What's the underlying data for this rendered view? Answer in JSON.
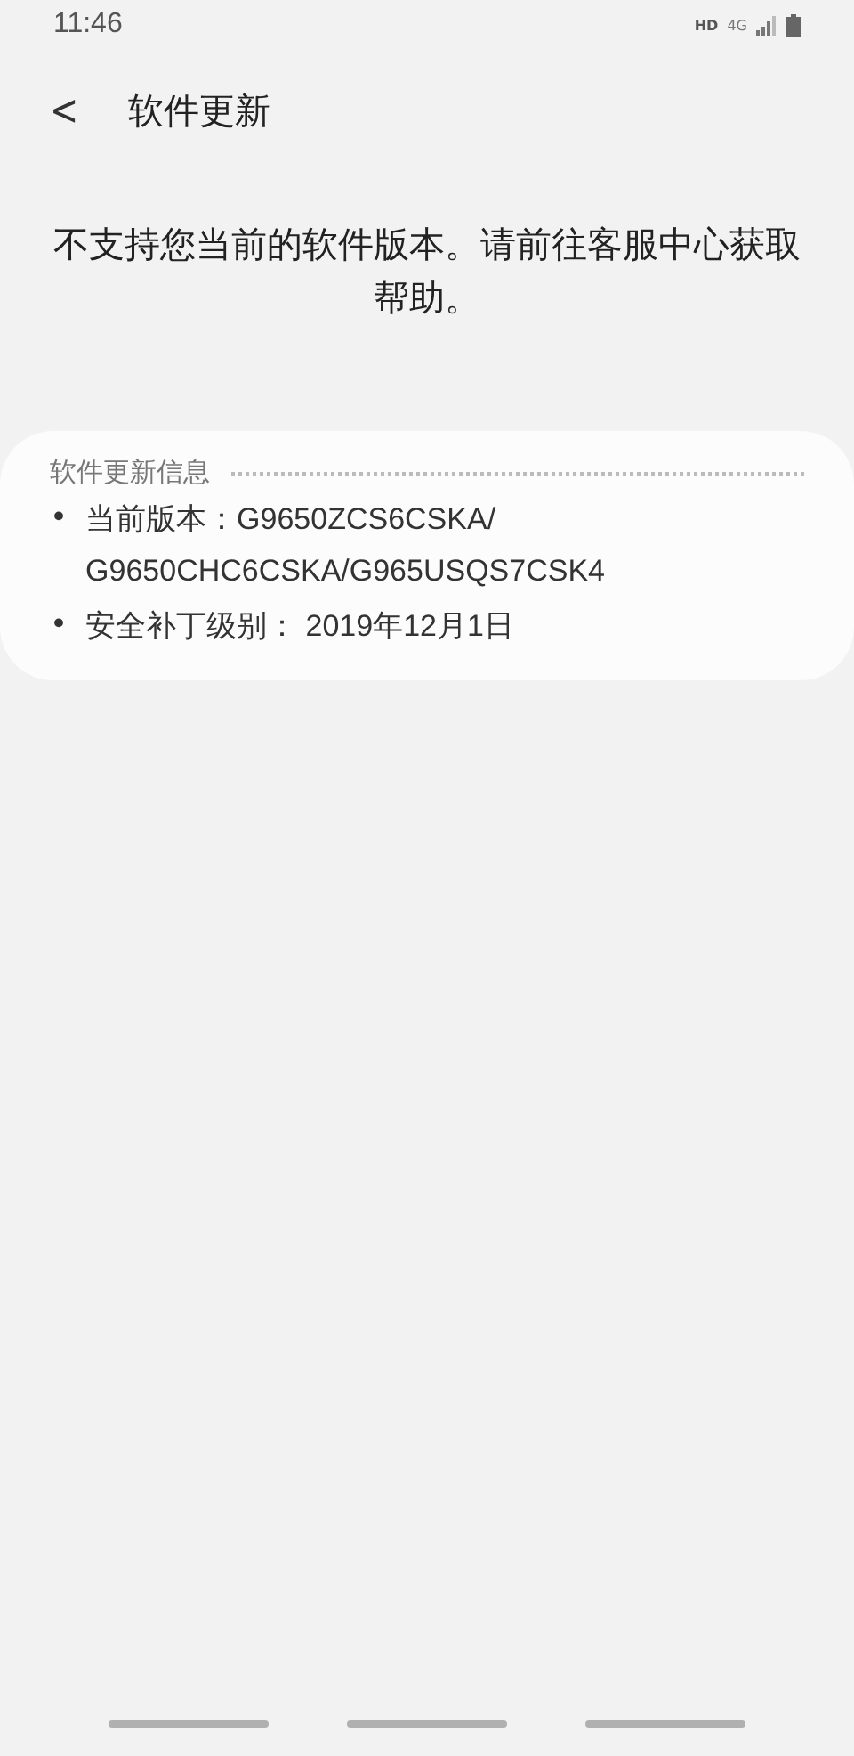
{
  "status_bar": {
    "time": "11:46",
    "hd": "HD",
    "network": "4G"
  },
  "header": {
    "back": "<",
    "title": "软件更新"
  },
  "message": "不支持您当前的软件版本。请前往客服中心获取帮助。",
  "info_card": {
    "title": "软件更新信息",
    "items": [
      {
        "bullet": "•",
        "text": "当前版本：G9650ZCS6CSKA/ G9650CHC6CSKA/G965USQS7CSK4"
      },
      {
        "bullet": "•",
        "text": "安全补丁级别： 2019年12月1日"
      }
    ]
  }
}
